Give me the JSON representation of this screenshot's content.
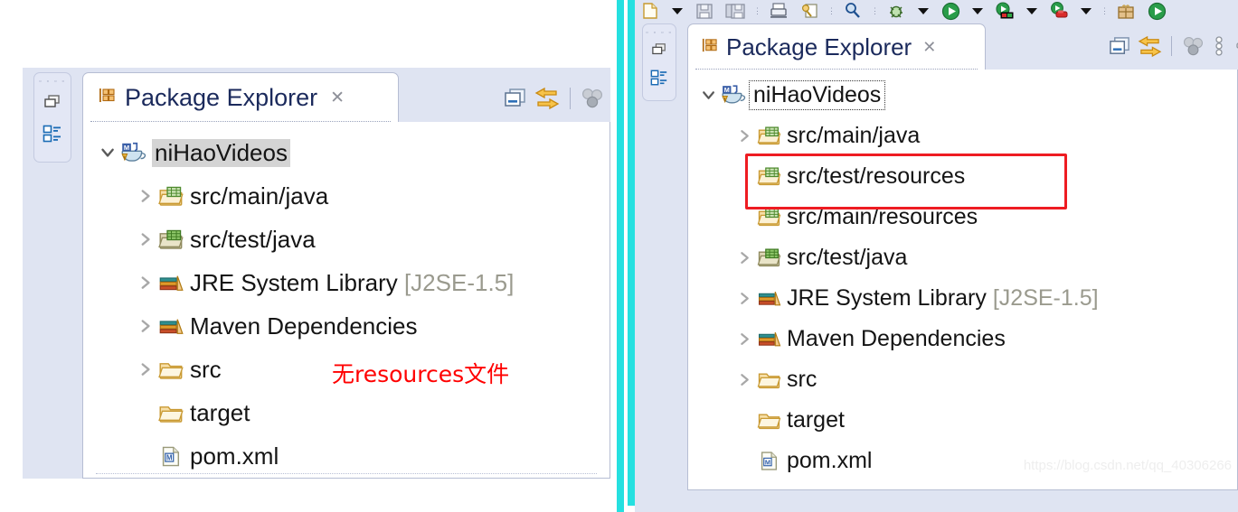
{
  "left_panel": {
    "fastbar": {
      "grip": "▫ ▫ ▫ ▫",
      "restore_icon": "restore-icon",
      "package_explorer_icon": "package-explorer-icon"
    },
    "tab": {
      "icon": "package-explorer-icon",
      "label": "Package Explorer",
      "close": "✕"
    },
    "view_toolbar": [
      {
        "icon": "collapse-all-icon",
        "tooltip": "Collapse All"
      },
      {
        "icon": "link-with-editor-icon",
        "tooltip": "Link with Editor"
      },
      {
        "icon": "view-menu-icon",
        "tooltip": "View Menu"
      }
    ],
    "tree": [
      {
        "indent": 0,
        "twisty": "expanded",
        "icon": "maven-project-icon",
        "label": "niHaoVideos",
        "suffix": "",
        "state": "selected"
      },
      {
        "indent": 1,
        "twisty": "collapsed",
        "icon": "source-folder-icon",
        "label": "src/main/java",
        "suffix": "",
        "state": "normal"
      },
      {
        "indent": 1,
        "twisty": "collapsed",
        "icon": "test-source-folder-icon",
        "label": "src/test/java",
        "suffix": "",
        "state": "normal"
      },
      {
        "indent": 1,
        "twisty": "collapsed",
        "icon": "library-icon",
        "label": "JRE System Library",
        "suffix": "[J2SE-1.5]",
        "state": "normal"
      },
      {
        "indent": 1,
        "twisty": "collapsed",
        "icon": "library-icon",
        "label": "Maven Dependencies",
        "suffix": "",
        "state": "normal"
      },
      {
        "indent": 1,
        "twisty": "collapsed",
        "icon": "folder-icon",
        "label": "src",
        "suffix": "",
        "state": "normal"
      },
      {
        "indent": 1,
        "twisty": "none",
        "icon": "folder-icon",
        "label": "target",
        "suffix": "",
        "state": "normal"
      },
      {
        "indent": 1,
        "twisty": "none",
        "icon": "xml-file-icon",
        "label": "pom.xml",
        "suffix": "",
        "state": "normal"
      }
    ],
    "annotation": "无resources文件"
  },
  "right_panel": {
    "toolbar": [
      {
        "icon": "new-file-icon"
      },
      {
        "icon": "dropdown-caret-icon"
      },
      {
        "icon": "save-icon"
      },
      {
        "icon": "save-all-icon"
      },
      {
        "icon": "separator-dots-icon"
      },
      {
        "icon": "print-icon"
      },
      {
        "icon": "build-icon"
      },
      {
        "icon": "separator-dots-icon"
      },
      {
        "icon": "search-icon"
      },
      {
        "icon": "separator-dots-icon"
      },
      {
        "icon": "debug-icon"
      },
      {
        "icon": "dropdown-caret-icon"
      },
      {
        "icon": "run-icon"
      },
      {
        "icon": "dropdown-caret-icon"
      },
      {
        "icon": "run-coverage-icon"
      },
      {
        "icon": "dropdown-caret-icon"
      },
      {
        "icon": "external-tools-icon"
      },
      {
        "icon": "dropdown-caret-icon"
      },
      {
        "icon": "separator-dots-icon"
      },
      {
        "icon": "package-gift-icon"
      },
      {
        "icon": "run-icon"
      }
    ],
    "fastbar": {
      "grip": "▫ ▫ ▫ ▫",
      "restore_icon": "restore-icon",
      "package_explorer_icon": "package-explorer-icon"
    },
    "tab": {
      "icon": "package-explorer-icon",
      "label": "Package Explorer",
      "close": "✕"
    },
    "view_toolbar": [
      {
        "icon": "collapse-all-icon",
        "tooltip": "Collapse All"
      },
      {
        "icon": "link-with-editor-icon",
        "tooltip": "Link with Editor"
      },
      {
        "icon": "view-menu-icon",
        "tooltip": "View Menu"
      },
      {
        "icon": "overflow-menu-icon",
        "tooltip": "View Menu"
      },
      {
        "icon": "minimize-icon",
        "tooltip": "Minimize"
      }
    ],
    "tree": [
      {
        "indent": 0,
        "twisty": "expanded",
        "icon": "maven-project-icon",
        "label": "niHaoVideos",
        "suffix": "",
        "state": "focus"
      },
      {
        "indent": 1,
        "twisty": "collapsed",
        "icon": "source-folder-icon",
        "label": "src/main/java",
        "suffix": "",
        "state": "normal"
      },
      {
        "indent": 1,
        "twisty": "none",
        "icon": "source-folder-icon",
        "label": "src/test/resources",
        "suffix": "",
        "state": "normal"
      },
      {
        "indent": 1,
        "twisty": "none",
        "icon": "source-folder-icon",
        "label": "src/main/resources",
        "suffix": "",
        "state": "normal"
      },
      {
        "indent": 1,
        "twisty": "collapsed",
        "icon": "test-source-folder-icon",
        "label": "src/test/java",
        "suffix": "",
        "state": "normal"
      },
      {
        "indent": 1,
        "twisty": "collapsed",
        "icon": "library-icon",
        "label": "JRE System Library",
        "suffix": "[J2SE-1.5]",
        "state": "normal"
      },
      {
        "indent": 1,
        "twisty": "collapsed",
        "icon": "library-icon",
        "label": "Maven Dependencies",
        "suffix": "",
        "state": "normal"
      },
      {
        "indent": 1,
        "twisty": "collapsed",
        "icon": "folder-icon",
        "label": "src",
        "suffix": "",
        "state": "normal"
      },
      {
        "indent": 1,
        "twisty": "none",
        "icon": "folder-icon",
        "label": "target",
        "suffix": "",
        "state": "normal"
      },
      {
        "indent": 1,
        "twisty": "none",
        "icon": "xml-file-icon",
        "label": "pom.xml",
        "suffix": "",
        "state": "normal"
      }
    ],
    "highlight_box": {
      "rows": [
        "src/test/resources",
        "src/main/resources"
      ],
      "color": "#ee1c22"
    },
    "watermark": "https://blog.csdn.net/qq_40306266"
  },
  "colors": {
    "chrome": "#dfe4f2",
    "tree_bg": "#ffffff",
    "tab_text": "#1b2a5c",
    "selection_grey": "#d4d4d4",
    "annotation_red": "#ff0000",
    "callout_red": "#ee1c22",
    "cyan_divider": "#25e0e0",
    "dim_text": "#9a9a8e"
  }
}
